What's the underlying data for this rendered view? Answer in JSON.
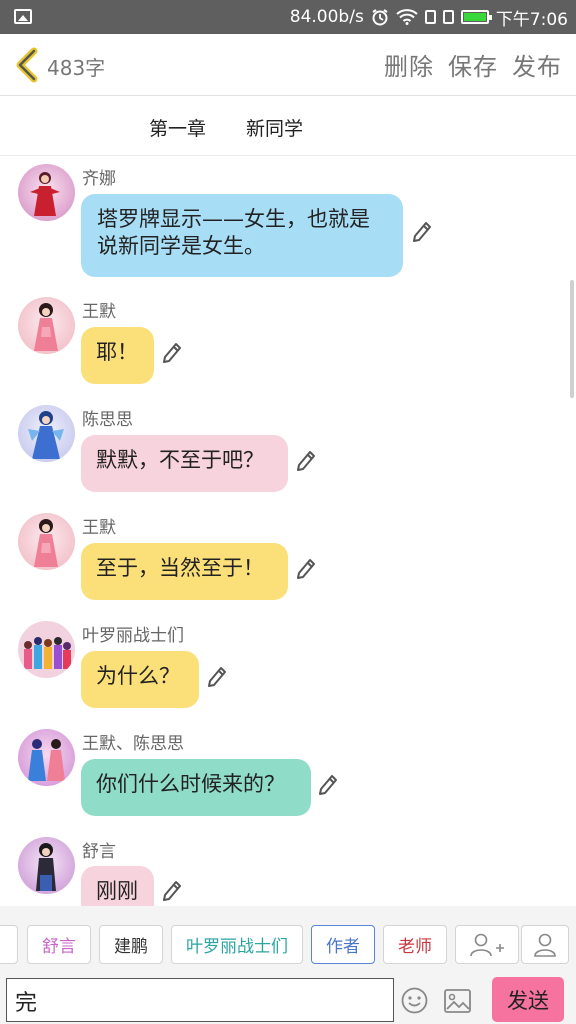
{
  "status_bar": {
    "speed": "84.00b/s",
    "time": "下午7:06"
  },
  "header": {
    "word_count": "483字",
    "delete_label": "删除",
    "save_label": "保存",
    "publish_label": "发布"
  },
  "chapter": {
    "number": "第一章",
    "title": "新同学"
  },
  "messages": [
    {
      "speaker": "齐娜",
      "text": "塔罗牌显示——女生，也就是说新同学是女生。",
      "color": "#a8def5"
    },
    {
      "speaker": "王默",
      "text": "耶！",
      "color": "#fbe07a"
    },
    {
      "speaker": "陈思思",
      "text": "默默，不至于吧？",
      "color": "#f7d3dd"
    },
    {
      "speaker": "王默",
      "text": "至于，当然至于！",
      "color": "#fbe07a"
    },
    {
      "speaker": "叶罗丽战士们",
      "text": "为什么？",
      "color": "#fbe07a"
    },
    {
      "speaker": "王默、陈思思",
      "text": "你们什么时候来的？",
      "color": "#8fdcc9"
    },
    {
      "speaker": "舒言",
      "text": "刚刚",
      "color": "#f7d3dd"
    }
  ],
  "tags": [
    {
      "label": "舒言",
      "color": "#c765c9"
    },
    {
      "label": "建鹏",
      "color": "#333333"
    },
    {
      "label": "叶罗丽战士们",
      "color": "#2aa5a0"
    },
    {
      "label": "作者",
      "color": "#4a78c8"
    },
    {
      "label": "老师",
      "color": "#c8373d"
    }
  ],
  "input": {
    "value": "完"
  },
  "send_label": "发送"
}
